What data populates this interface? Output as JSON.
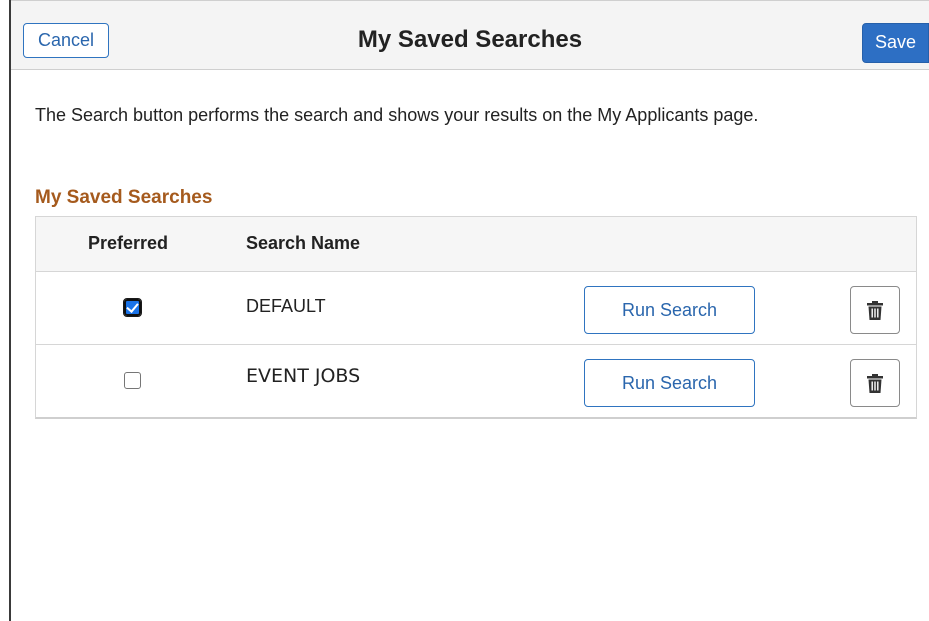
{
  "header": {
    "cancel_label": "Cancel",
    "title": "My Saved Searches",
    "save_label": "Save"
  },
  "instructions": "The Search button performs the search and shows your results on the My Applicants page.",
  "section": {
    "title": "My Saved Searches"
  },
  "table": {
    "columns": [
      "Preferred",
      "Search Name"
    ],
    "rows": [
      {
        "preferred": true,
        "name": "DEFAULT",
        "run_label": "Run Search",
        "delete_icon": "trash-icon"
      },
      {
        "preferred": false,
        "name": "EVENT JOBS",
        "run_label": "Run Search",
        "delete_icon": "trash-icon"
      }
    ]
  },
  "colors": {
    "accent": "#2d6fc4",
    "section_title": "#a55a1d"
  }
}
